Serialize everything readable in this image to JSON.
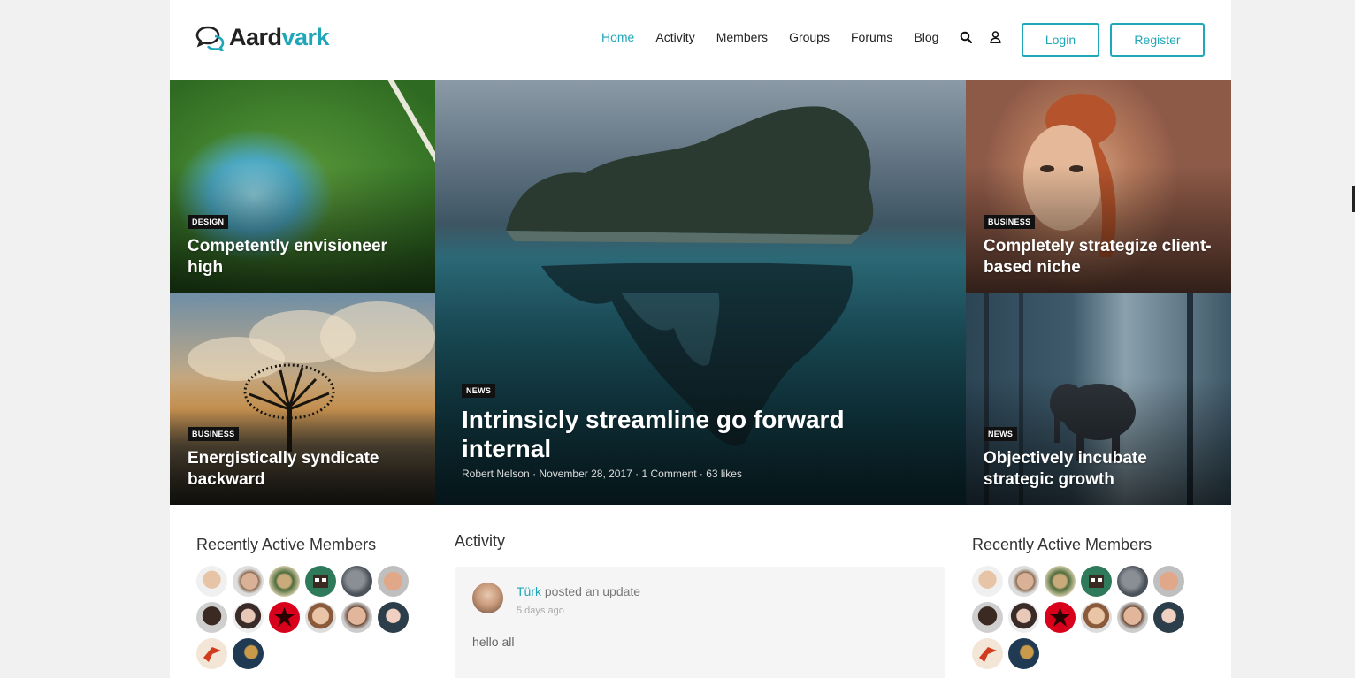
{
  "brand": {
    "name_dark": "Aard",
    "name_accent": "vark",
    "accent_color": "#1fa6b8"
  },
  "nav": {
    "items": [
      "Home",
      "Activity",
      "Members",
      "Groups",
      "Forums",
      "Blog"
    ],
    "active": "Home",
    "search_icon": "search-icon",
    "user_icon": "user-icon",
    "login_label": "Login",
    "register_label": "Register"
  },
  "hero": {
    "top_left": {
      "tag": "DESIGN",
      "title": "Competently envisioneer high"
    },
    "bottom_left": {
      "tag": "BUSINESS",
      "title": "Energistically syndicate backward"
    },
    "center": {
      "tag": "NEWS",
      "title": "Intrinsicly streamline go forward internal",
      "author": "Robert Nelson",
      "date": "November 28, 2017",
      "comments": "1 Comment",
      "likes": "63 likes"
    },
    "top_right": {
      "tag": "BUSINESS",
      "title": "Completely strategize client-based niche"
    },
    "bottom_right": {
      "tag": "NEWS",
      "title": "Objectively incubate strategic growth"
    }
  },
  "left_widget": {
    "title": "Recently Active Members"
  },
  "right_widget": {
    "title": "Recently Active Members"
  },
  "activity": {
    "title": "Activity",
    "user": "Türk",
    "action": " posted an update",
    "time": "5 days ago",
    "text": "hello all"
  }
}
